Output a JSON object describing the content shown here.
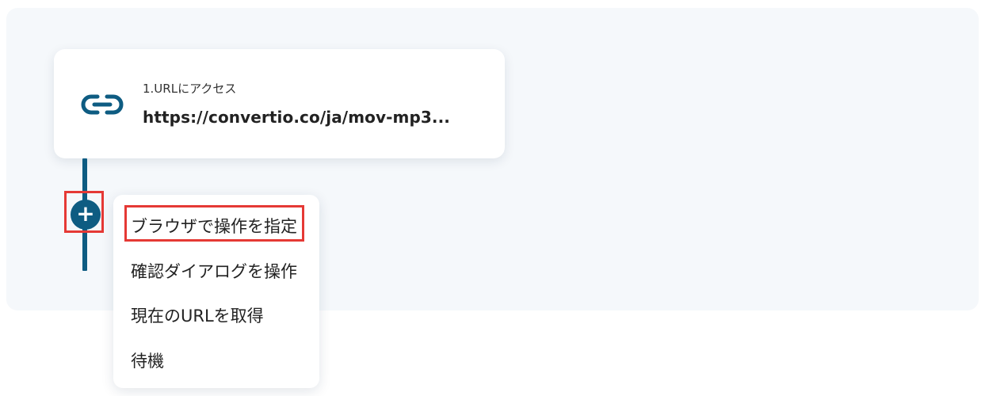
{
  "flow": {
    "step": {
      "icon": "link-icon",
      "label": "1.URLにアクセス",
      "value": "https://convertio.co/ja/mov-mp3..."
    },
    "add_button": {
      "icon": "plus-icon",
      "symbol": "+"
    },
    "menu": {
      "items": [
        {
          "label": "ブラウザで操作を指定"
        },
        {
          "label": "確認ダイアログを操作"
        },
        {
          "label": "現在のURLを取得"
        },
        {
          "label": "待機"
        }
      ]
    }
  },
  "colors": {
    "accent": "#0e5c82",
    "highlight": "#e53935",
    "canvas_bg": "#f5f8fb"
  }
}
